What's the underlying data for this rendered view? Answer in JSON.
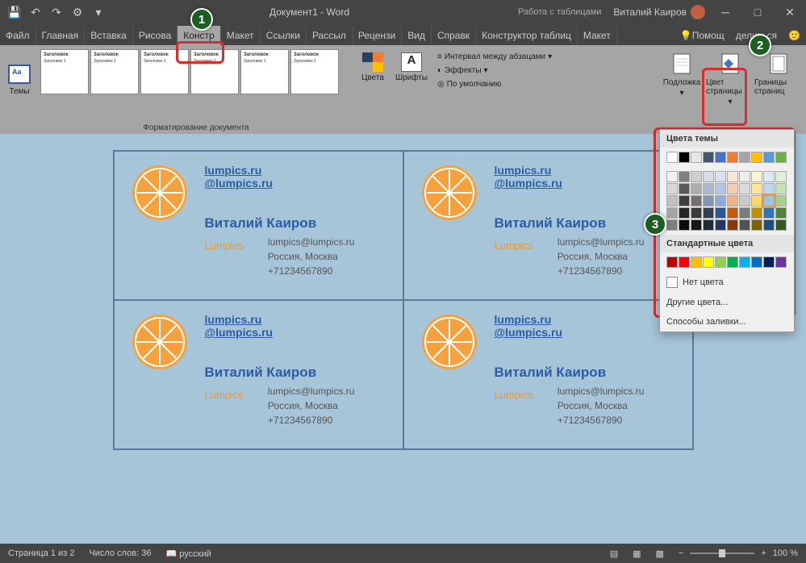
{
  "title": "Документ1 - Word",
  "tableTools": "Работа с таблицами",
  "user": "Виталий Каиров",
  "tabs": [
    "Файл",
    "Главная",
    "Вставка",
    "Рисова",
    "Констр",
    "Макет",
    "Ссылки",
    "Рассыл",
    "Рецензи",
    "Вид",
    "Справк",
    "Конструктор таблиц",
    "Макет"
  ],
  "help": "Помощ",
  "share": "делиться",
  "ribbon": {
    "themes": "Темы",
    "galHead": "Заголовок",
    "galSub": "Заголовок 1",
    "colors": "Цвета",
    "fonts": "Шрифты",
    "paraSpacing": "Интервал между абзацами",
    "effects": "Эффекты",
    "default": "По умолчанию",
    "formatGroup": "Форматирование документа",
    "watermark": "Подложка",
    "pageColor": "Цвет страницы",
    "pageBorders": "Границы страниц"
  },
  "colorPanel": {
    "themeColors": "Цвета темы",
    "standardColors": "Стандартные цвета",
    "noColor": "Нет цвета",
    "moreColors": "Другие цвета...",
    "fillEffects": "Способы заливки...",
    "themeRow": [
      "#ffffff",
      "#000000",
      "#e7e6e6",
      "#44546a",
      "#4472c4",
      "#ed7d31",
      "#a5a5a5",
      "#ffc000",
      "#5b9bd5",
      "#70ad47"
    ],
    "tintRows": [
      [
        "#f2f2f2",
        "#808080",
        "#d0cece",
        "#d6dce4",
        "#d9e2f3",
        "#fbe5d5",
        "#ededed",
        "#fff2cc",
        "#deebf6",
        "#e2efd9"
      ],
      [
        "#d8d8d8",
        "#595959",
        "#aeabab",
        "#adb9ca",
        "#b4c6e7",
        "#f7cbac",
        "#dbdbdb",
        "#fee599",
        "#bdd7ee",
        "#c5e0b3"
      ],
      [
        "#bfbfbf",
        "#3f3f3f",
        "#757070",
        "#8496b0",
        "#8eaadb",
        "#f4b183",
        "#c9c9c9",
        "#ffd965",
        "#9cc3e5",
        "#a8d08d"
      ],
      [
        "#a5a5a5",
        "#262626",
        "#3a3838",
        "#323f4f",
        "#2f5496",
        "#c55a11",
        "#7b7b7b",
        "#bf9000",
        "#2e75b5",
        "#538135"
      ],
      [
        "#7f7f7f",
        "#0c0c0c",
        "#171616",
        "#222a35",
        "#1f3864",
        "#833c0b",
        "#525252",
        "#7f6000",
        "#1e4e79",
        "#375623"
      ]
    ],
    "stdRow": [
      "#c00000",
      "#ff0000",
      "#ffc000",
      "#ffff00",
      "#92d050",
      "#00b050",
      "#00b0f0",
      "#0070c0",
      "#002060",
      "#7030a0"
    ]
  },
  "card": {
    "link1": "lumpics.ru",
    "link2": "@lumpics.ru",
    "name": "Виталий Каиров",
    "company": "Lumpics",
    "email": "lumpics@lumpics.ru",
    "location": "Россия, Москва",
    "phone": "+71234567890"
  },
  "status": {
    "page": "Страница 1 из 2",
    "words": "Число слов: 36",
    "lang": "русский",
    "zoom": "100 %"
  }
}
